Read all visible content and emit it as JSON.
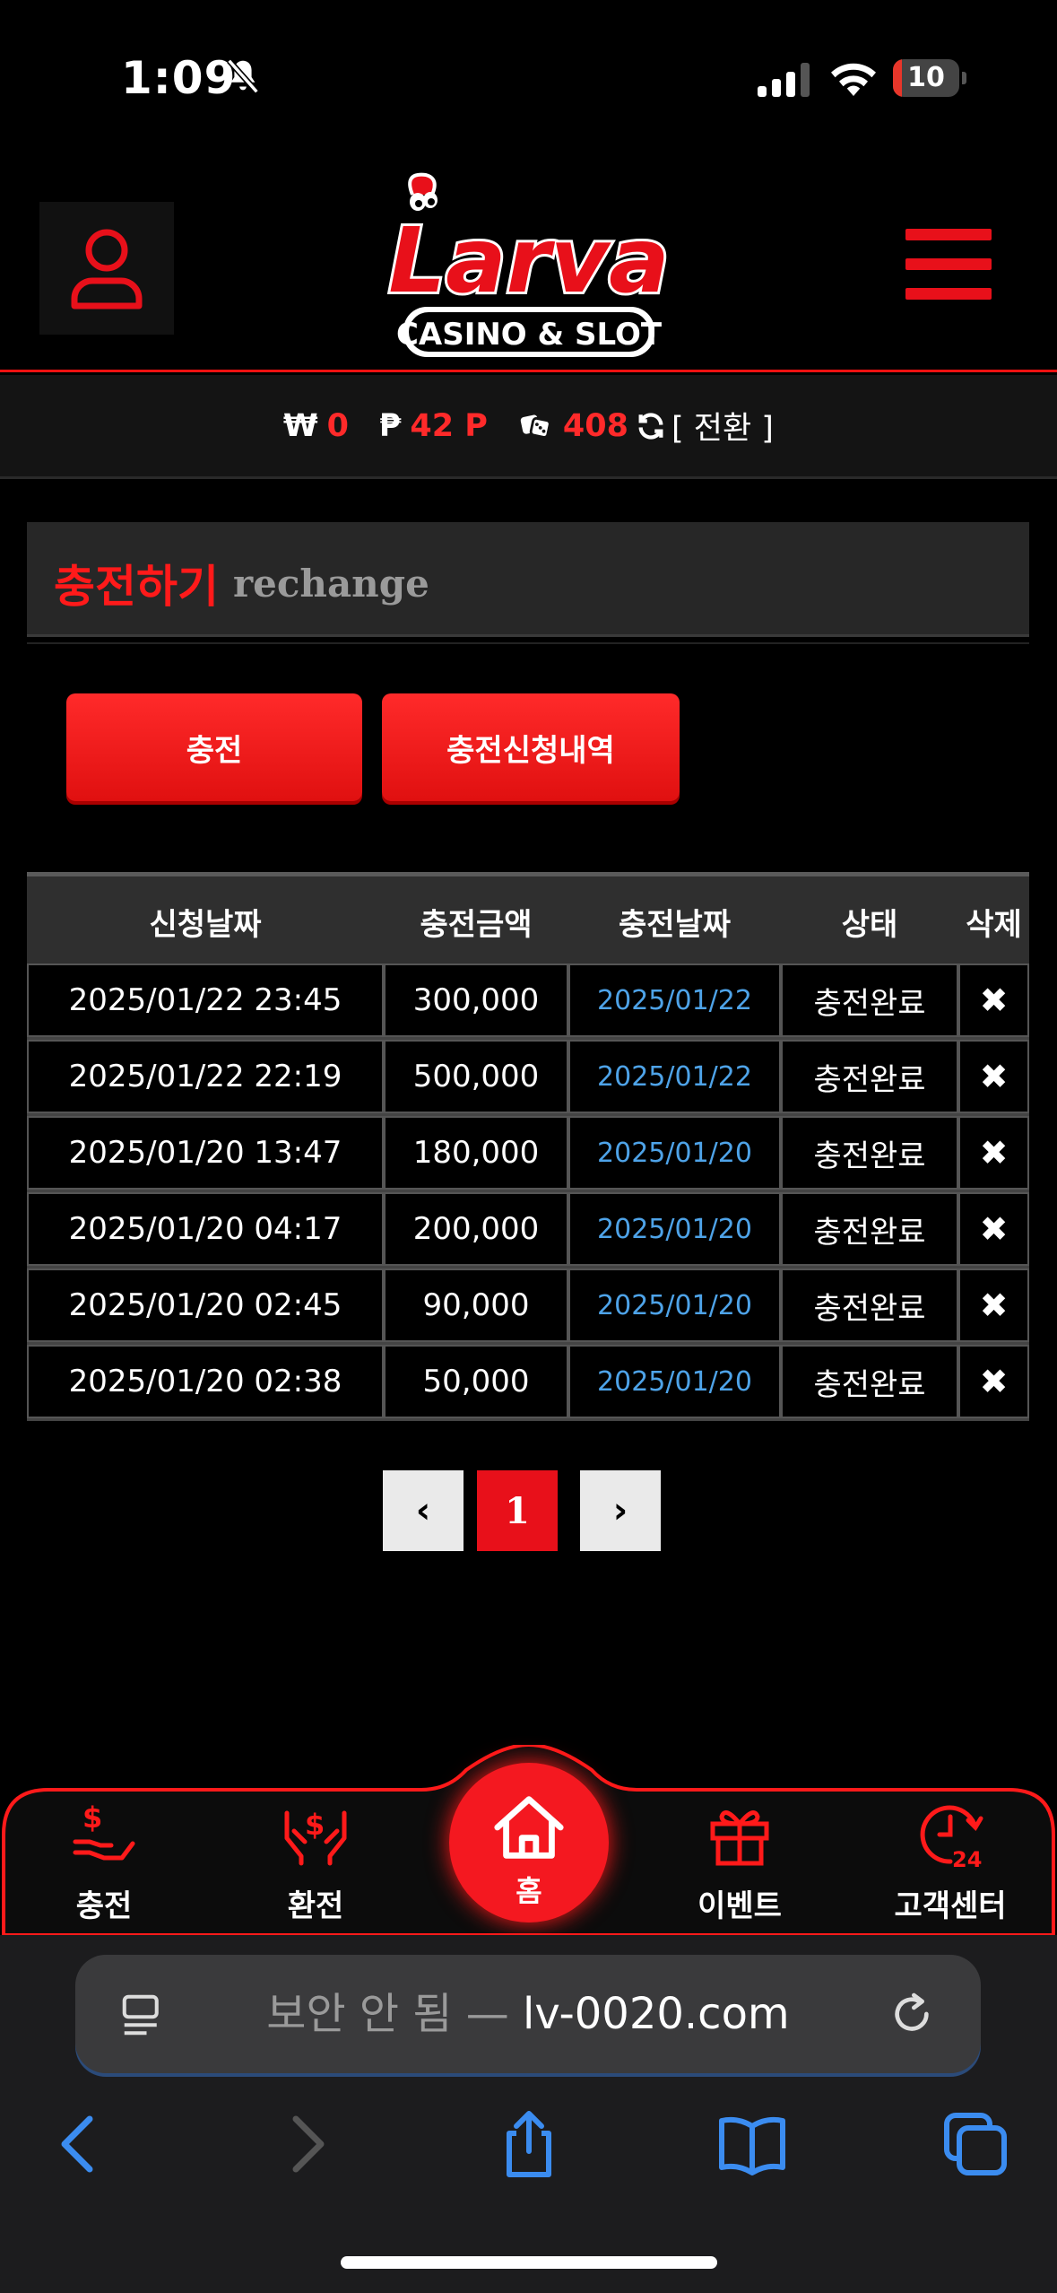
{
  "status_bar": {
    "time": "1:09",
    "battery_level": "10"
  },
  "header": {
    "logo_text": "Larva",
    "logo_subtext": "CASINO & SLOT"
  },
  "balance": {
    "won_symbol": "₩",
    "won_value": "0",
    "point_symbol": "₱",
    "point_value": "42 P",
    "chip_value": "408",
    "switch_label": "[ 전환 ]"
  },
  "section": {
    "title_ko": "충전하기",
    "title_en": "rechange"
  },
  "buttons": {
    "charge": "충전",
    "history": "충전신청내역"
  },
  "table": {
    "headers": [
      "신청날짜",
      "충전금액",
      "충전날짜",
      "상태",
      "삭제"
    ],
    "rows": [
      {
        "request_date": "2025/01/22 23:45",
        "amount": "300,000",
        "charge_date": "2025/01/22",
        "status": "충전완료",
        "delete": "✖"
      },
      {
        "request_date": "2025/01/22 22:19",
        "amount": "500,000",
        "charge_date": "2025/01/22",
        "status": "충전완료",
        "delete": "✖"
      },
      {
        "request_date": "2025/01/20 13:47",
        "amount": "180,000",
        "charge_date": "2025/01/20",
        "status": "충전완료",
        "delete": "✖"
      },
      {
        "request_date": "2025/01/20 04:17",
        "amount": "200,000",
        "charge_date": "2025/01/20",
        "status": "충전완료",
        "delete": "✖"
      },
      {
        "request_date": "2025/01/20 02:45",
        "amount": "90,000",
        "charge_date": "2025/01/20",
        "status": "충전완료",
        "delete": "✖"
      },
      {
        "request_date": "2025/01/20 02:38",
        "amount": "50,000",
        "charge_date": "2025/01/20",
        "status": "충전완료",
        "delete": "✖"
      }
    ]
  },
  "pagination": {
    "prev": "‹",
    "current": "1",
    "next": "›"
  },
  "bottom_nav": {
    "items": [
      {
        "label": "충전",
        "icon": "deposit-icon"
      },
      {
        "label": "환전",
        "icon": "exchange-icon"
      },
      {
        "label": "홈",
        "icon": "home-icon"
      },
      {
        "label": "이벤트",
        "icon": "gift-icon"
      },
      {
        "label": "고객센터",
        "icon": "support-24-icon"
      }
    ]
  },
  "browser": {
    "insecure_label": "보안 안 됨 —",
    "domain": "lv-0020.com"
  },
  "colors": {
    "accent": "#e8101a",
    "link_date": "#4ea3e8",
    "background": "#000000"
  }
}
